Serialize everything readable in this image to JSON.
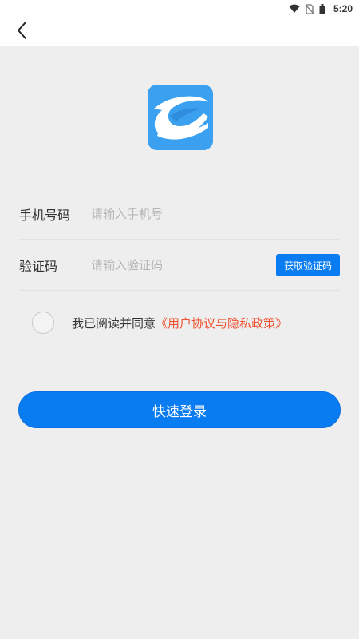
{
  "status_bar": {
    "time": "5:20",
    "icons": [
      "wifi-icon",
      "no-sim-icon",
      "battery-icon"
    ]
  },
  "nav": {
    "back_icon": "chevron-left-icon"
  },
  "logo": {
    "icon": "app-logo-icon",
    "color": "#3aa0ef"
  },
  "form": {
    "phone": {
      "label": "手机号码",
      "placeholder": "请输入手机号",
      "value": ""
    },
    "code": {
      "label": "验证码",
      "placeholder": "请输入验证码",
      "value": "",
      "button_label": "获取验证码"
    }
  },
  "agreement": {
    "checked": false,
    "text": "我已阅读并同意",
    "link_text": "《用户协议与隐私政策》",
    "link_color": "#f0502e"
  },
  "login_button": {
    "label": "快速登录",
    "color": "#0a7cf2"
  }
}
